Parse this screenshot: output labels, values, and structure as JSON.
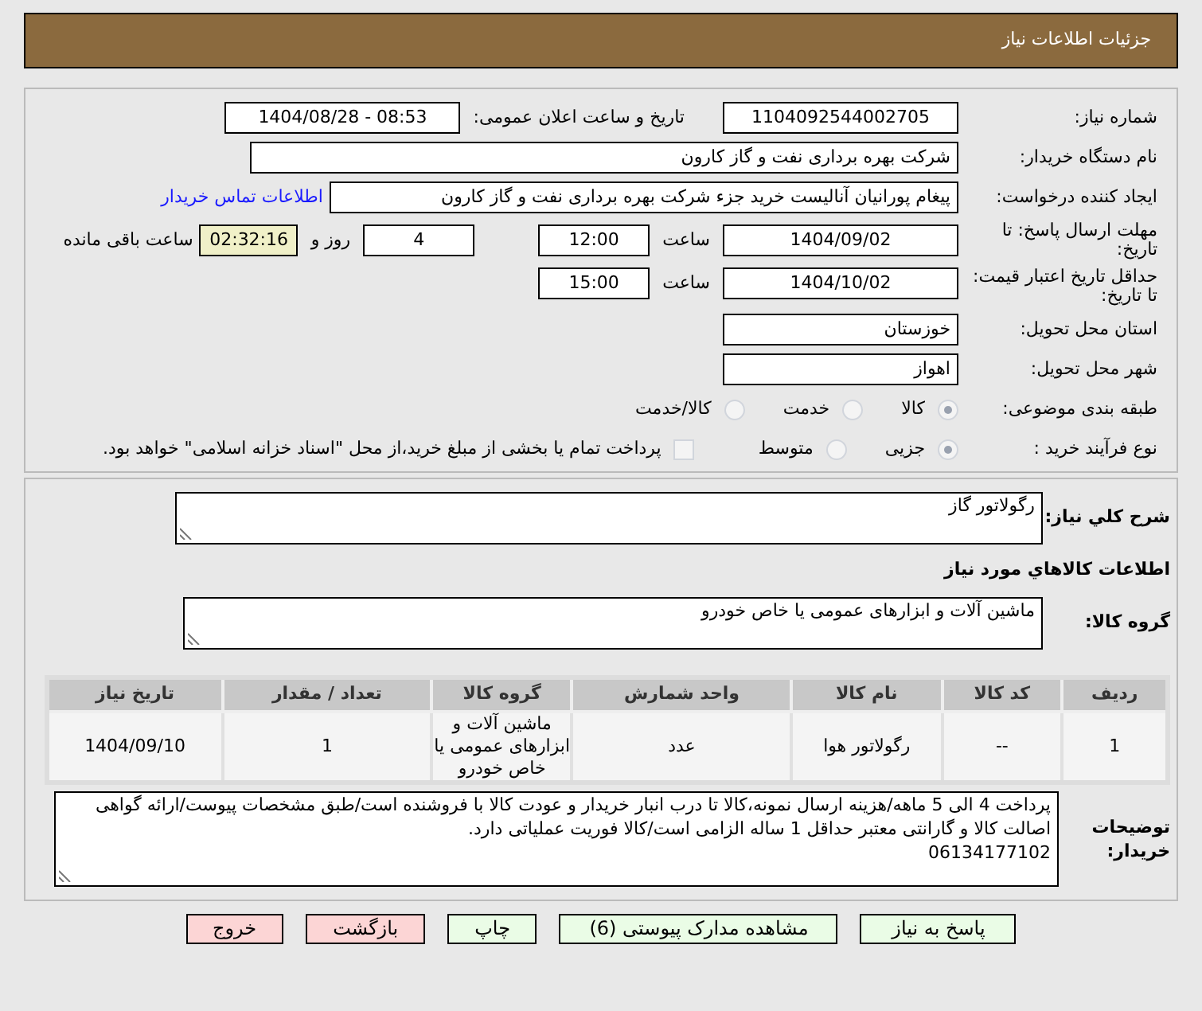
{
  "header": {
    "title": "جزئیات اطلاعات نیاز"
  },
  "need_number": {
    "label": "شماره نیاز:",
    "value": "1104092544002705"
  },
  "announce": {
    "label": "تاریخ و ساعت اعلان عمومی:",
    "value": "1404/08/28 - 08:53"
  },
  "buyer": {
    "label": "نام دستگاه خریدار:",
    "value": "شرکت بهره برداری نفت و گاز کارون"
  },
  "creator": {
    "label": "ایجاد کننده درخواست:",
    "value": "پیغام پورانیان آنالیست خرید جزء شرکت بهره برداری نفت و گاز کارون",
    "link": "اطلاعات تماس خریدار"
  },
  "deadline": {
    "label": "مهلت ارسال پاسخ: تا تاریخ:",
    "date": "1404/09/02",
    "time_label": "ساعت",
    "time": "12:00",
    "days": "4",
    "days_label": "روز و",
    "remaining": "02:32:16",
    "remaining_label": "ساعت باقی مانده"
  },
  "validity": {
    "label": "حداقل تاریخ اعتبار قیمت: تا تاریخ:",
    "date": "1404/10/02",
    "time_label": "ساعت",
    "time": "15:00"
  },
  "province": {
    "label": "استان محل تحویل:",
    "value": "خوزستان"
  },
  "city": {
    "label": "شهر محل تحویل:",
    "value": "اهواز"
  },
  "category": {
    "label": "طبقه بندی موضوعی:",
    "options": [
      {
        "label": "کالا",
        "selected": true
      },
      {
        "label": "خدمت",
        "selected": false
      },
      {
        "label": "کالا/خدمت",
        "selected": false
      }
    ]
  },
  "process": {
    "label": "نوع فرآیند خرید :",
    "options": [
      {
        "label": "جزیی",
        "selected": true
      },
      {
        "label": "متوسط",
        "selected": false
      }
    ],
    "treasury": {
      "checked": false,
      "label": "پرداخت تمام یا بخشی از مبلغ خرید،از محل \"اسناد خزانه اسلامی\" خواهد بود."
    }
  },
  "summary": {
    "label": "شرح کلي نياز:",
    "value": "رگولاتور گاز"
  },
  "goods_heading": "اطلاعات كالاهاي مورد نياز",
  "goods_group": {
    "label": "گروه کالا:",
    "value": "ماشین آلات و ابزارهای عمومی یا خاص خودرو"
  },
  "table": {
    "columns": [
      "ردیف",
      "کد کالا",
      "نام کالا",
      "واحد شمارش",
      "گروه کالا",
      "تعداد / مقدار",
      "تاریخ نیاز"
    ],
    "rows": [
      [
        "1",
        "--",
        "رگولاتور هوا",
        "عدد",
        "ماشین آلات و ابزارهای عمومی یا خاص خودرو",
        "1",
        "1404/09/10"
      ]
    ]
  },
  "notes": {
    "label": "توضیحات خریدار:",
    "value": "پرداخت 4 الی 5 ماهه/هزینه ارسال نمونه،کالا تا درب انبار خریدار و عودت کالا با فروشنده است/طبق مشخصات پیوست/ارائه گواهی اصالت کالا و گارانتی معتبر حداقل 1 ساله الزامی است/کالا فوریت عملیاتی دارد.\n06134177102"
  },
  "buttons": [
    {
      "label": "پاسخ به نیاز",
      "kind": "action"
    },
    {
      "label": "مشاهده مدارک پیوستی (6)",
      "kind": "action"
    },
    {
      "label": "چاپ",
      "kind": "action"
    },
    {
      "label": "بازگشت",
      "kind": "exit"
    },
    {
      "label": "خروج",
      "kind": "exit"
    }
  ]
}
